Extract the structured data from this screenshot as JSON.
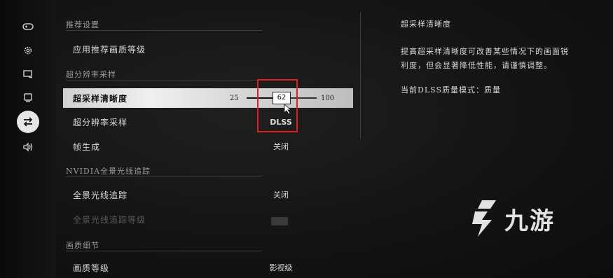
{
  "sidebar": {
    "icons": [
      {
        "name": "gamepad-icon",
        "glyph": "⊡"
      },
      {
        "name": "gear-icon",
        "glyph": "⚙"
      },
      {
        "name": "display-icon",
        "glyph": "▭"
      },
      {
        "name": "monitor-icon",
        "glyph": "▣"
      },
      {
        "name": "graphics-settings-icon",
        "glyph": "⇄"
      },
      {
        "name": "audio-icon",
        "glyph": "◁)"
      }
    ],
    "active_index": 4
  },
  "settings": {
    "section_recommended": "推荐设置",
    "apply_recommended": "应用推荐画质等级",
    "section_super_resolution": "超分辨率采样",
    "sharpness": {
      "label": "超采样清晰度",
      "min": "25",
      "max": "100",
      "value": "62",
      "fraction": 0.49
    },
    "super_sampling": {
      "label": "超分辨率采样",
      "value": "DLSS"
    },
    "frame_gen": {
      "label": "帧生成",
      "value": "关闭"
    },
    "section_raytracing": "NVIDIA全景光线追踪",
    "raytracing": {
      "label": "全景光线追踪",
      "value": "关闭"
    },
    "raytracing_level": {
      "label": "全景光线追踪等级"
    },
    "section_quality": "画质细节",
    "quality_level": {
      "label": "画质等级",
      "value": "影视级"
    }
  },
  "description": {
    "title": "超采样清晰度",
    "body": "提高超采样清晰度可改善某些情况下的画面锐利度，但会显著降低性能，请谨慎调整。",
    "mode": "当前DLSS质量模式：质量"
  },
  "watermark": {
    "text": "九游"
  },
  "colors": {
    "accent_red": "#e02020",
    "background": "#111111",
    "selected_row": "#e6e6e6"
  }
}
